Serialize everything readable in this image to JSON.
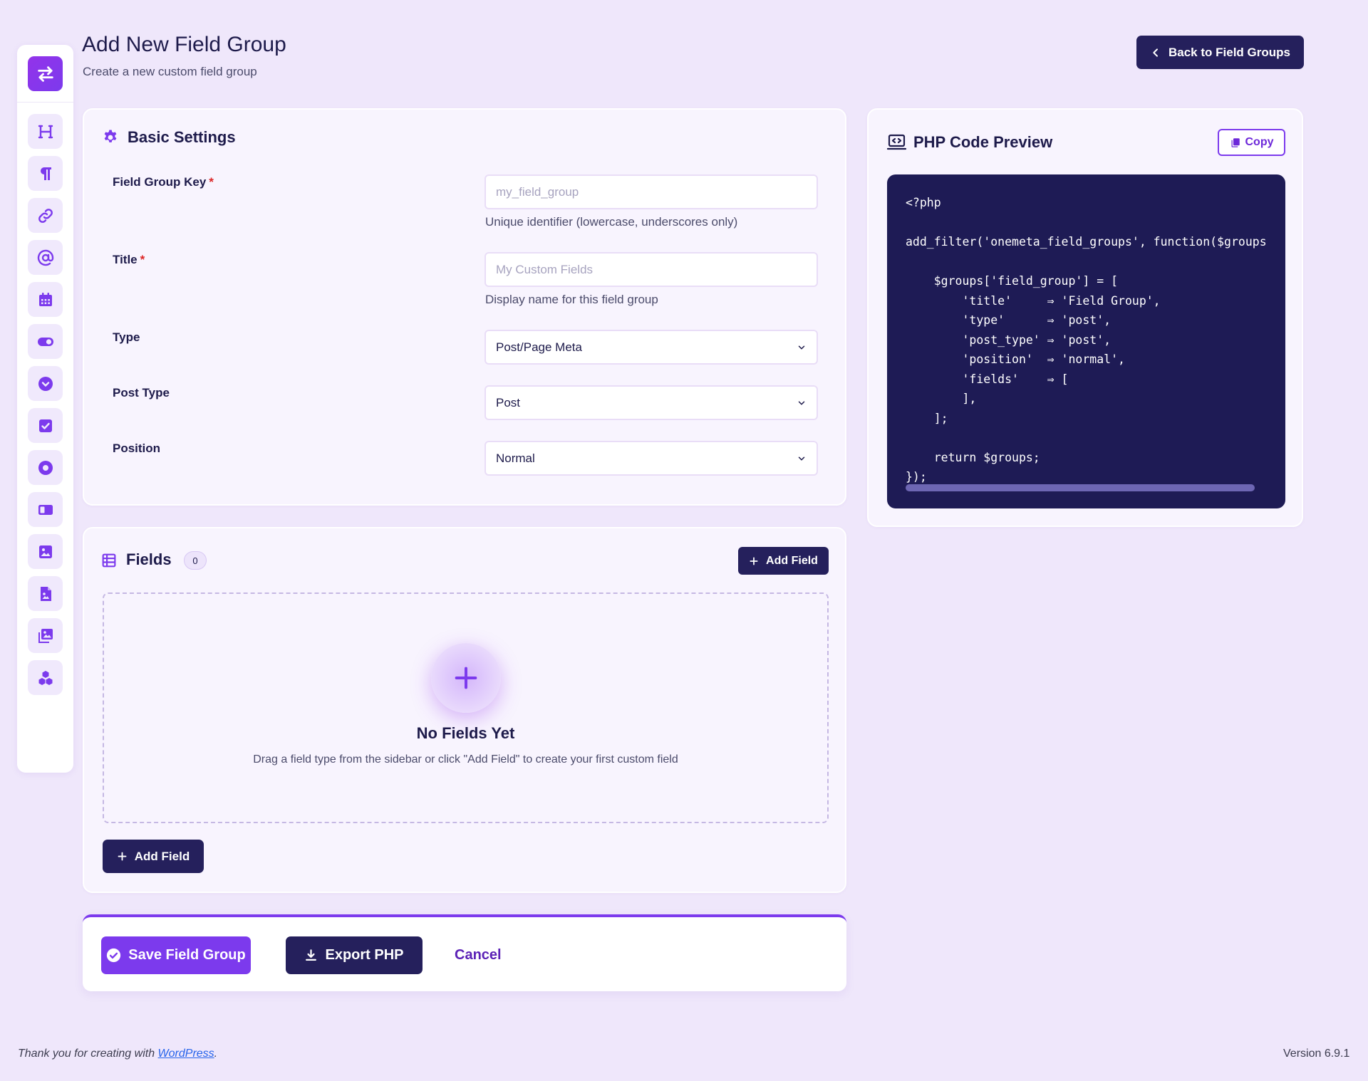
{
  "header": {
    "title": "Add New Field Group",
    "subtitle": "Create a new custom field group",
    "back_label": "Back to Field Groups"
  },
  "sidebar": {
    "items": [
      {
        "name": "heading",
        "icon": "heading-icon"
      },
      {
        "name": "paragraph",
        "icon": "paragraph-icon"
      },
      {
        "name": "link",
        "icon": "link-icon"
      },
      {
        "name": "email",
        "icon": "at-sign-icon"
      },
      {
        "name": "date",
        "icon": "calendar-icon"
      },
      {
        "name": "toggle",
        "icon": "toggle-icon"
      },
      {
        "name": "select",
        "icon": "chevron-circle-icon"
      },
      {
        "name": "checkbox",
        "icon": "checkbox-icon"
      },
      {
        "name": "radio",
        "icon": "radio-icon"
      },
      {
        "name": "button-group",
        "icon": "button-group-icon"
      },
      {
        "name": "image",
        "icon": "image-icon"
      },
      {
        "name": "file",
        "icon": "file-icon"
      },
      {
        "name": "gallery",
        "icon": "gallery-icon"
      },
      {
        "name": "repeater",
        "icon": "cubes-icon"
      }
    ]
  },
  "basic_settings": {
    "title": "Basic Settings",
    "key_label": "Field Group Key",
    "key_placeholder": "my_field_group",
    "key_help": "Unique identifier (lowercase, underscores only)",
    "title_label": "Title",
    "title_placeholder": "My Custom Fields",
    "title_help": "Display name for this field group",
    "required_mark": "*",
    "type_label": "Type",
    "type_value": "Post/Page Meta",
    "post_type_label": "Post Type",
    "post_type_value": "Post",
    "position_label": "Position",
    "position_value": "Normal"
  },
  "preview": {
    "title": "PHP Code Preview",
    "copy_label": "Copy",
    "code": "<?php\n\nadd_filter('onemeta_field_groups', function($groups) {\n\n    $groups['field_group'] = [\n        'title'     ⇒ 'Field Group',\n        'type'      ⇒ 'post',\n        'post_type' ⇒ 'post',\n        'position'  ⇒ 'normal',\n        'fields'    ⇒ [\n        ],\n    ];\n\n    return $groups;\n});"
  },
  "fields": {
    "title": "Fields",
    "count": "0",
    "add_label": "Add Field",
    "empty_title": "No Fields Yet",
    "empty_text": "Drag a field type from the sidebar or click \"Add Field\" to create your first custom field"
  },
  "actions": {
    "save_label": "Save Field Group",
    "export_label": "Export PHP",
    "cancel_label": "Cancel"
  },
  "footer": {
    "thanks_prefix": "Thank you for creating with ",
    "link_text": "WordPress",
    "thanks_suffix": ".",
    "version": "Version 6.9.1"
  },
  "colors": {
    "primary": "#7c3aed",
    "dark": "#25205c",
    "code_bg": "#1e1b55",
    "page_bg": "#efe7fb",
    "required": "#dc2626"
  }
}
